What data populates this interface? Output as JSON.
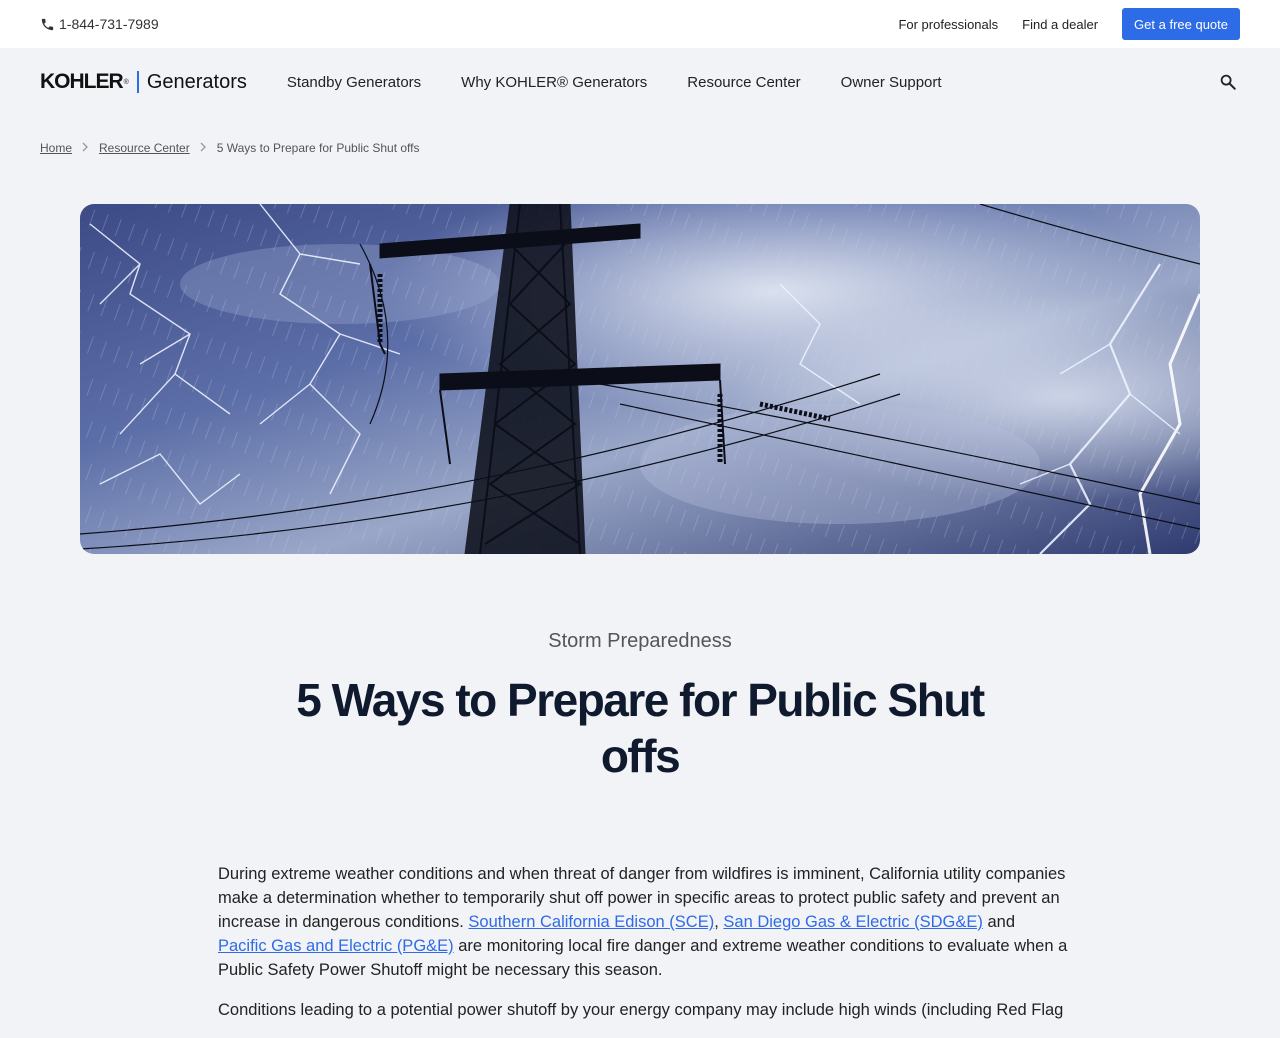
{
  "topbar": {
    "phone": "1-844-731-7989",
    "links": [
      "For professionals",
      "Find a dealer"
    ],
    "quote_button": "Get a free quote"
  },
  "logo": {
    "brand": "KOHLER",
    "product": "Generators"
  },
  "nav": {
    "items": [
      "Standby Generators",
      "Why KOHLER® Generators",
      "Resource Center",
      "Owner Support"
    ]
  },
  "breadcrumb": {
    "home": "Home",
    "section": "Resource Center",
    "current": "5 Ways to Prepare for Public Shut offs"
  },
  "article": {
    "category": "Storm Preparedness",
    "title": "5 Ways to Prepare for Public Shut offs",
    "p1_a": "During extreme weather conditions and when threat of danger from wildfires is imminent, California utility companies make a determination whether to temporarily shut off power in specific areas to protect public safety and prevent an increase in dangerous conditions. ",
    "link_sce": "Southern California Edison (SCE)",
    "sep1": ", ",
    "link_sdge": "San Diego Gas & Electric (SDG&E)",
    "sep2": " and ",
    "link_pge": "Pacific Gas and Electric (PG&E)",
    "p1_b": " are monitoring local fire danger and extreme weather conditions to evaluate when a Public Safety Power Shutoff might be necessary this season.",
    "p2": "Conditions leading to a potential power shutoff by your energy company may include high winds (including Red Flag"
  },
  "colors": {
    "accent": "#2e6be6",
    "background": "#f2f3f7",
    "title": "#0f1a2e"
  },
  "icons": {
    "phone": "phone-icon",
    "search": "search-icon",
    "breadcrumb_separator": "chevron-right-icon"
  }
}
